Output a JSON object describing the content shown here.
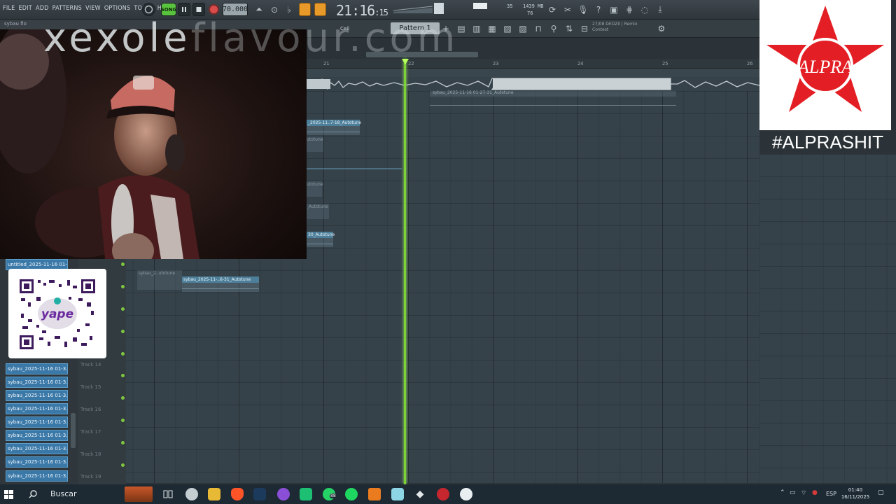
{
  "menu": [
    "FILE",
    "EDIT",
    "ADD",
    "PATTERNS",
    "VIEW",
    "OPTIONS",
    "TOOLS",
    "HELP"
  ],
  "toolbar": {
    "song_label": "SONG",
    "tempo": "70.000",
    "time_main": "21:16",
    "time_sub": "15",
    "memory": "1439 MB",
    "cpu": "35",
    "polyphony": "76",
    "hint_line1": "27/08 DEDZII | Remix",
    "hint_line2": "Contest",
    "pattern": "Pattern 1",
    "cell_label": "Cell"
  },
  "watermark": {
    "solid": "xexole",
    "faint": "flavour.com"
  },
  "tab_strip": "sybau flo",
  "timeline": {
    "bars": [
      "21",
      "22",
      "23",
      "24",
      "25",
      "26"
    ]
  },
  "clips": {
    "top": "sybau_2025-11-16 01-27-31_Autotune",
    "c1": "_2025-11..7-18_Autotune",
    "c2": "utotune",
    "c3": "utotune",
    "c4": "_Autotune",
    "c5": "30_Autotune",
    "c6_ghost": "sybau_2..utotune",
    "c6": "sybau_2025-11-..6-31_Autotune"
  },
  "browser_items": [
    "untitled_2025-11-16 01-...",
    "sybau_2025-11-16 01-3...",
    "sybau_2025-11-16 01-3...",
    "sybau_2025-11-16 01-3...",
    "sybau_2025-11-16 01-3...",
    "sybau_2025-11-16 01-3...",
    "sybau_2025-11-16 01-3...",
    "sybau_2025-11-16 01-3...",
    "sybau_2025-11-16 01-3...",
    "sybau_2025-11-16 01-3..."
  ],
  "tracks": [
    "Track 14",
    "Track 15",
    "Track 16",
    "Track 17",
    "Track 18",
    "Track 19"
  ],
  "qr": {
    "brand": "yape"
  },
  "alpra": {
    "logo_text": "ALPRA",
    "hashtag": "#ALPRASHIT"
  },
  "taskbar": {
    "search": "Buscar",
    "lang": "ESP",
    "time": "01:40",
    "date": "16/11/2025",
    "whatsapp_badge": "88"
  },
  "colors": {
    "playhead": "#7fd13a",
    "clip": "#4e7f9a",
    "browser_item": "#3a78a8",
    "alpra_red": "#e31e24"
  }
}
